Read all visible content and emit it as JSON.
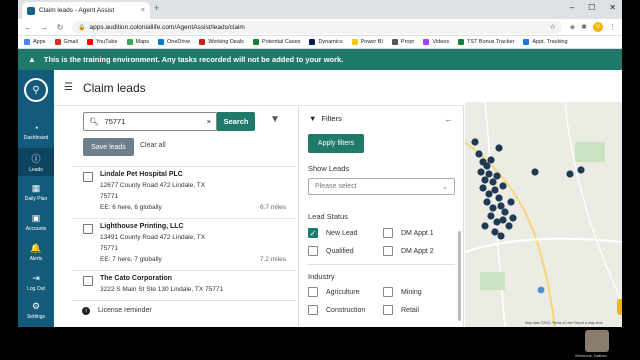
{
  "browser": {
    "tab_title": "Claim leads - Agent Assist",
    "tab_close": "×",
    "new_tab": "+",
    "url": "apps.audition.coloniallife.com/AgentAssist/leads/claim",
    "window_controls": [
      "–",
      "☐",
      "✕"
    ],
    "profile_initial": "V"
  },
  "bookmarks": [
    {
      "label": "Apps",
      "color": "#4285f4"
    },
    {
      "label": "Gmail",
      "color": "#d93025"
    },
    {
      "label": "YouTube",
      "color": "#ff0000"
    },
    {
      "label": "Maps",
      "color": "#34a853"
    },
    {
      "label": "OneDrive",
      "color": "#0078d4"
    },
    {
      "label": "Working Deals",
      "color": "#c5221f"
    },
    {
      "label": "Potential Cases",
      "color": "#188038"
    },
    {
      "label": "Dynamics",
      "color": "#002050"
    },
    {
      "label": "Power BI",
      "color": "#f2c811"
    },
    {
      "label": "Propr",
      "color": "#555555"
    },
    {
      "label": "Videos",
      "color": "#a142f4"
    },
    {
      "label": "TST Bonus Tracker",
      "color": "#188038"
    },
    {
      "label": "Appt. Tracking",
      "color": "#1a73e8"
    }
  ],
  "banner": {
    "text": "This is the training environment. Any tasks recorded will not be added to your work."
  },
  "nav": {
    "items": [
      {
        "label": "Dashboard",
        "icon": "◔"
      },
      {
        "label": "Leads",
        "icon": "ⓘ"
      },
      {
        "label": "Daily Plan",
        "icon": "▦"
      },
      {
        "label": "Accounts",
        "icon": "▣"
      },
      {
        "label": "Alerts",
        "icon": "🔔"
      },
      {
        "label": "Log Out",
        "icon": "⇥"
      },
      {
        "label": "Settings",
        "icon": "⚙"
      }
    ]
  },
  "header": {
    "title": "Claim leads"
  },
  "search": {
    "value": "75771",
    "button": "Search",
    "clear": "×"
  },
  "actions": {
    "save_leads": "Save leads",
    "clear_all": "Clear all"
  },
  "leads": [
    {
      "name": "Lindale Pet Hospital PLC",
      "address": "12677 County Road 472 Lindale, TX",
      "zip": "75771",
      "ee": "EE: 6 here, 6 globally",
      "distance": "6.7 miles"
    },
    {
      "name": "Lighthouse Printing, LLC",
      "address": "13491 County Road 472 Lindale, TX",
      "zip": "75771",
      "ee": "EE: 7 here, 7 globally",
      "distance": "7.2 miles"
    },
    {
      "name": "The Cato Corporation",
      "address": "3222 S Main St Ste 130 Lindale, TX 75771",
      "zip": "",
      "ee": "",
      "distance": ""
    }
  ],
  "reminder": {
    "text": "License reminder",
    "icon": "i"
  },
  "filters": {
    "title": "Filters",
    "apply": "Apply filters",
    "back": "←",
    "show_leads_label": "Show Leads",
    "show_leads_placeholder": "Please select",
    "lead_status_label": "Lead Status",
    "lead_status": [
      {
        "label": "New Lead",
        "checked": true
      },
      {
        "label": "DM Appt 1",
        "checked": false
      },
      {
        "label": "Qualified",
        "checked": false
      },
      {
        "label": "DM Appt 2",
        "checked": false
      }
    ],
    "industry_label": "Industry",
    "industry": [
      {
        "label": "Agriculture",
        "checked": false
      },
      {
        "label": "Mining",
        "checked": false
      },
      {
        "label": "Construction",
        "checked": false
      },
      {
        "label": "Retail",
        "checked": false
      }
    ]
  },
  "map": {
    "footer": "Map data ©2021   Terms of Use   Report a map error",
    "marker_color": "#1f3a52",
    "selected_marker_color": "#4a8fd0"
  },
  "user": {
    "name": "Simmons, Nathan"
  }
}
